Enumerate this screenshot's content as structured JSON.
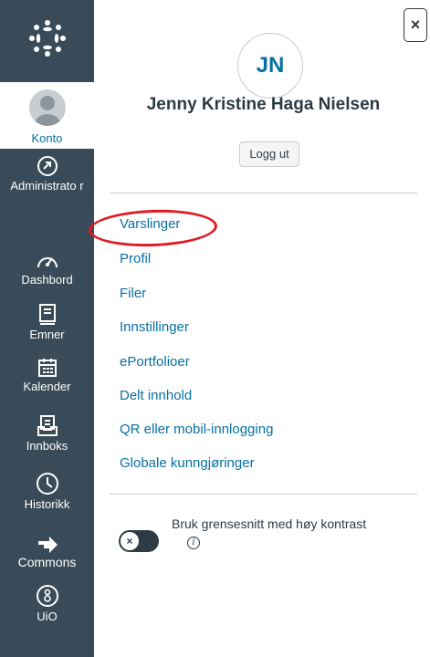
{
  "sidebar": {
    "logo_icon": "canvas-logo-icon",
    "items": [
      {
        "label": "Konto",
        "icon": "user-avatar-icon",
        "active": true
      },
      {
        "label": "Administrato r",
        "icon": "shield-icon"
      },
      {
        "label": "Dashbord",
        "icon": "dashboard-gauge-icon"
      },
      {
        "label": "Emner",
        "icon": "book-icon"
      },
      {
        "label": "Kalender",
        "icon": "calendar-icon"
      },
      {
        "label": "Innboks",
        "icon": "inbox-icon"
      },
      {
        "label": "Historikk",
        "icon": "clock-icon"
      },
      {
        "label": "Commons",
        "icon": "commons-arrow-icon"
      },
      {
        "label": "UiO",
        "icon": "uio-icon"
      }
    ]
  },
  "panel": {
    "close_label": "×",
    "avatar_initials": "JN",
    "user_name": "Jenny Kristine Haga Nielsen",
    "logout_label": "Logg ut",
    "links": [
      "Varslinger",
      "Profil",
      "Filer",
      "Innstillinger",
      "ePortfolioer",
      "Delt innhold",
      "QR eller mobil-innlogging",
      "Globale kunngjøringer"
    ],
    "highlighted_link": "Varslinger",
    "contrast_label": "Bruk grensesnitt med høy kontrast",
    "contrast_toggle_symbol": "×",
    "info_symbol": "i"
  },
  "colors": {
    "sidebar_bg": "#394b58",
    "link": "#0770a3",
    "highlight": "#e01b24"
  }
}
